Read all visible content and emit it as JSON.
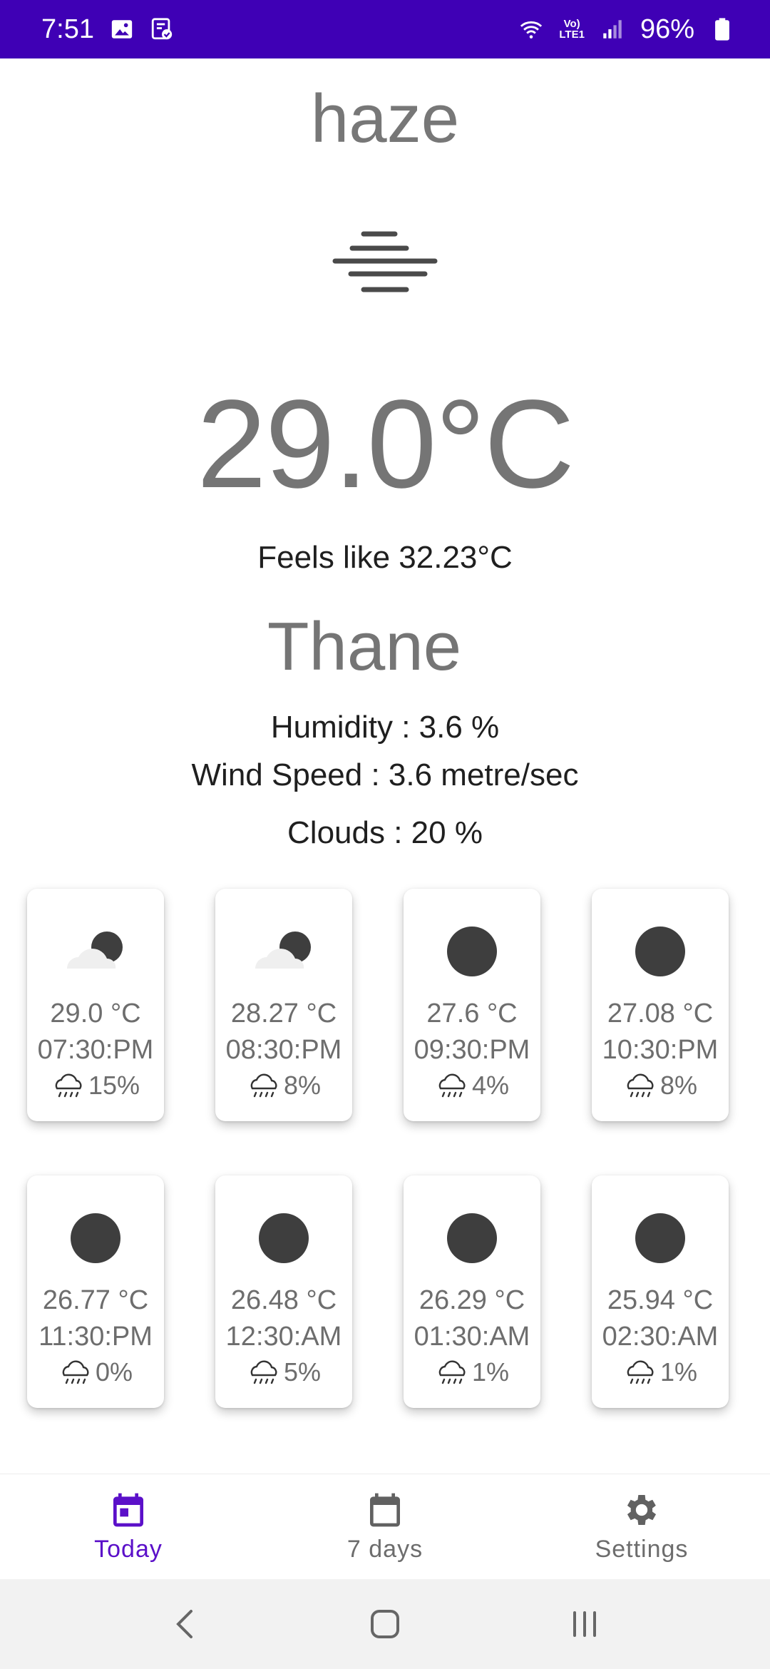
{
  "status_bar": {
    "time": "7:51",
    "battery": "96%",
    "net_top": "Vo)",
    "net_bottom": "LTE1"
  },
  "weather": {
    "condition": "haze",
    "temperature": "29.0°C",
    "feels_like": "Feels like 32.23°C",
    "city": "Thane",
    "humidity": "Humidity : 3.6 %",
    "wind_speed": "Wind Speed : 3.6 metre/sec",
    "clouds": "Clouds : 20 %"
  },
  "hourly": [
    {
      "icon": "partly-cloudy-night-icon",
      "temp": "29.0 °C",
      "time": "07:30:PM",
      "rain": "15%"
    },
    {
      "icon": "partly-cloudy-night-icon",
      "temp": "28.27 °C",
      "time": "08:30:PM",
      "rain": "8%"
    },
    {
      "icon": "clear-night-icon",
      "temp": "27.6 °C",
      "time": "09:30:PM",
      "rain": "4%"
    },
    {
      "icon": "clear-night-icon",
      "temp": "27.08 °C",
      "time": "10:30:PM",
      "rain": "8%"
    },
    {
      "icon": "clear-night-icon",
      "temp": "26.77 °C",
      "time": "11:30:PM",
      "rain": "0%"
    },
    {
      "icon": "clear-night-icon",
      "temp": "26.48 °C",
      "time": "12:30:AM",
      "rain": "5%"
    },
    {
      "icon": "clear-night-icon",
      "temp": "26.29 °C",
      "time": "01:30:AM",
      "rain": "1%"
    },
    {
      "icon": "clear-night-icon",
      "temp": "25.94 °C",
      "time": "02:30:AM",
      "rain": "1%"
    }
  ],
  "bottom_nav": {
    "today": "Today",
    "seven_days": "7 days",
    "settings": "Settings",
    "active": "today"
  },
  "colors": {
    "status_bar": "#3f00b5",
    "accent": "#5b10c9",
    "muted_text": "#757575"
  }
}
